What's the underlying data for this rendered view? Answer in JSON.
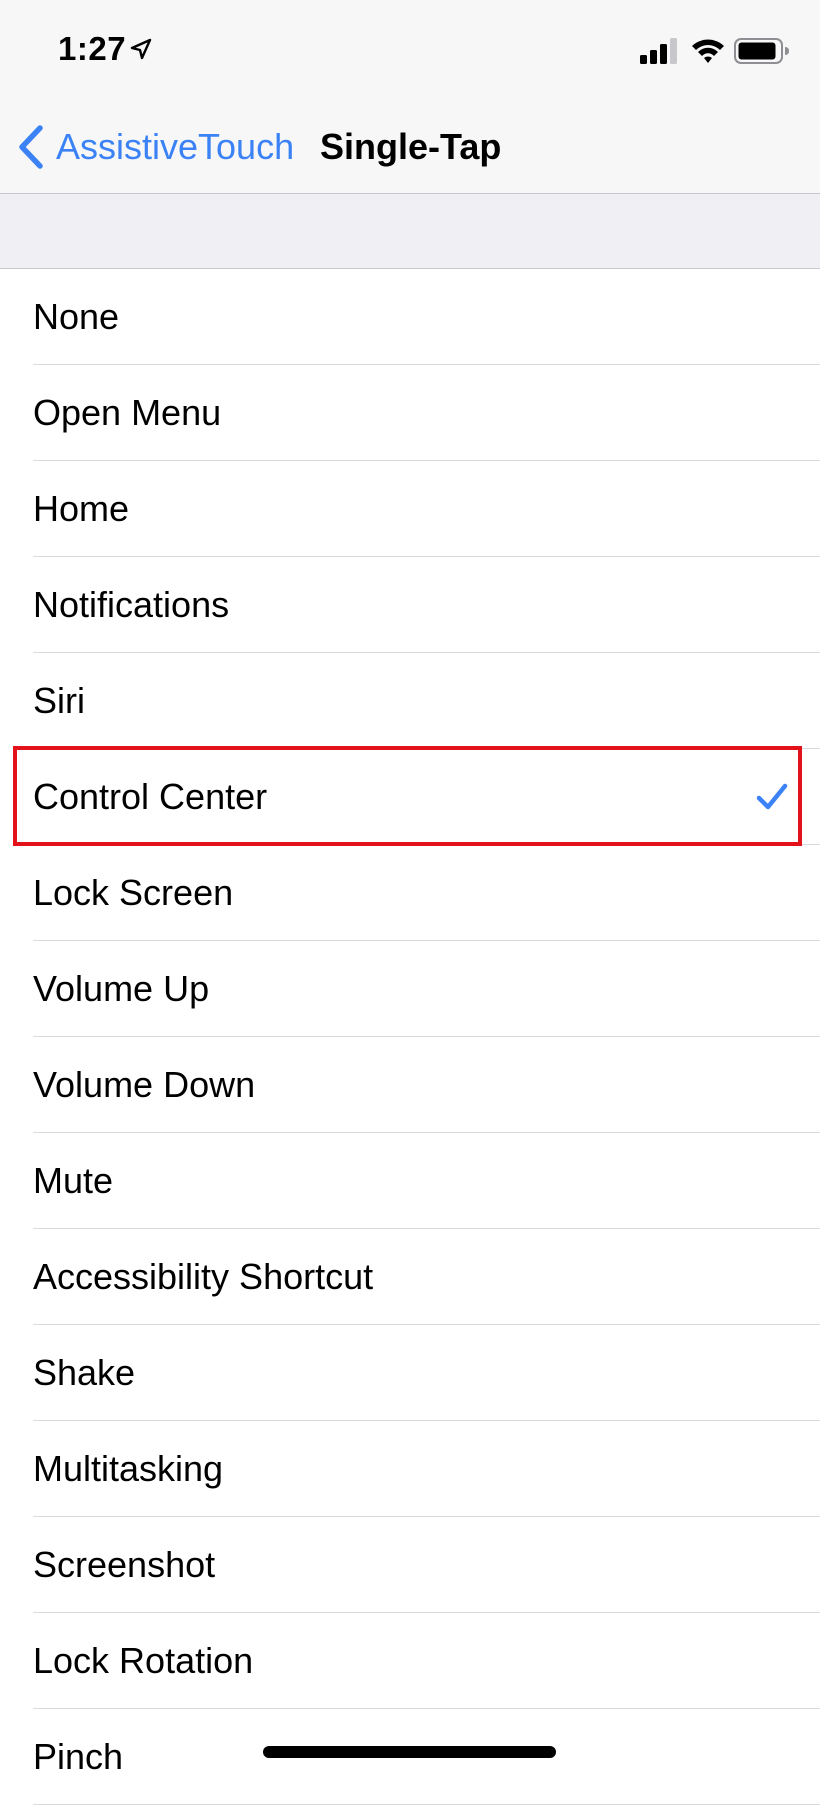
{
  "status_bar": {
    "time": "1:27"
  },
  "nav": {
    "back_label": "AssistiveTouch",
    "title": "Single-Tap"
  },
  "options": [
    {
      "label": "None",
      "selected": false
    },
    {
      "label": "Open Menu",
      "selected": false
    },
    {
      "label": "Home",
      "selected": false
    },
    {
      "label": "Notifications",
      "selected": false
    },
    {
      "label": "Siri",
      "selected": false
    },
    {
      "label": "Control Center",
      "selected": true
    },
    {
      "label": "Lock Screen",
      "selected": false
    },
    {
      "label": "Volume Up",
      "selected": false
    },
    {
      "label": "Volume Down",
      "selected": false
    },
    {
      "label": "Mute",
      "selected": false
    },
    {
      "label": "Accessibility Shortcut",
      "selected": false
    },
    {
      "label": "Shake",
      "selected": false
    },
    {
      "label": "Multitasking",
      "selected": false
    },
    {
      "label": "Screenshot",
      "selected": false
    },
    {
      "label": "Lock Rotation",
      "selected": false
    },
    {
      "label": "Pinch",
      "selected": false
    }
  ],
  "icons": {
    "back": "chevron-left-icon",
    "selected": "checkmark-icon",
    "location": "location-arrow-icon",
    "signal": "cellular-signal-icon",
    "wifi": "wifi-icon",
    "battery": "battery-icon"
  },
  "colors": {
    "accent": "#3b82f6",
    "highlight_border": "#e3121a",
    "bar_background": "#f7f7f7",
    "group_background": "#efeff4"
  }
}
